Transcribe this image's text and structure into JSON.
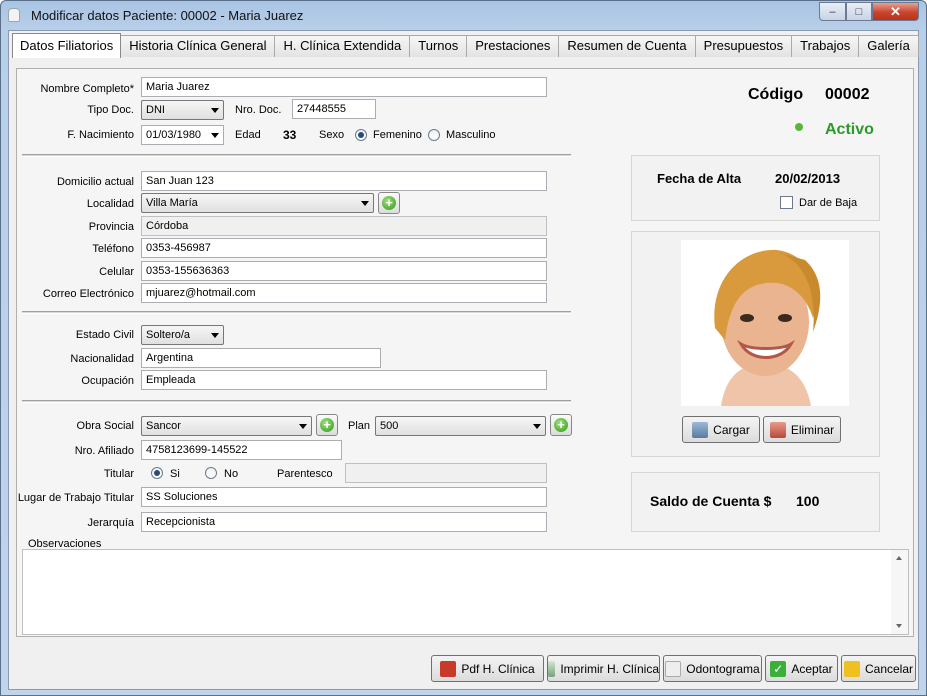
{
  "window": {
    "title": "Modificar datos Paciente: 00002 - Maria Juarez",
    "min": "–",
    "max": "□",
    "close": "✕"
  },
  "tabs": [
    "Datos Filiatorios",
    "Historia Clínica General",
    "H. Clínica Extendida",
    "Turnos",
    "Prestaciones",
    "Resumen de Cuenta",
    "Presupuestos",
    "Trabajos",
    "Galería"
  ],
  "form": {
    "nombre_label": "Nombre Completo*",
    "nombre": "Maria Juarez",
    "tipo_doc_label": "Tipo Doc.",
    "tipo_doc": "DNI",
    "nro_doc_label": "Nro. Doc.",
    "nro_doc": "27448555",
    "nacimiento_label": "F. Nacimiento",
    "nacimiento": "01/03/1980",
    "edad_label": "Edad",
    "edad": "33",
    "sexo_label": "Sexo",
    "sexo_f": "Femenino",
    "sexo_m": "Masculino",
    "domicilio_label": "Domicilio actual",
    "domicilio": "San Juan 123",
    "localidad_label": "Localidad",
    "localidad": "Villa María",
    "provincia_label": "Provincia",
    "provincia": "Córdoba",
    "telefono_label": "Teléfono",
    "telefono": "0353-456987",
    "celular_label": "Celular",
    "celular": "0353-155636363",
    "correo_label": "Correo Electrónico",
    "correo": "mjuarez@hotmail.com",
    "estado_civil_label": "Estado Civil",
    "estado_civil": "Soltero/a",
    "nacionalidad_label": "Nacionalidad",
    "nacionalidad": "Argentina",
    "ocupacion_label": "Ocupación",
    "ocupacion": "Empleada",
    "obra_social_label": "Obra Social",
    "obra_social": "Sancor",
    "plan_label": "Plan",
    "plan": "500",
    "afiliado_label": "Nro. Afiliado",
    "afiliado": "4758123699-145522",
    "titular_label": "Titular",
    "titular_si": "Si",
    "titular_no": "No",
    "parentesco_label": "Parentesco",
    "parentesco": "",
    "lugar_trabajo_label": "Lugar de Trabajo Titular",
    "lugar_trabajo": "SS Soluciones",
    "jerarquia_label": "Jerarquía",
    "jerarquia": "Recepcionista",
    "observaciones_label": "Observaciones",
    "observaciones": "",
    "add_symbol": "+"
  },
  "side": {
    "codigo_label": "Código",
    "codigo": "00002",
    "estado": "Activo",
    "estado_color": "#2a9a2a",
    "fecha_alta_label": "Fecha de Alta",
    "fecha_alta": "20/02/2013",
    "dar_baja": "Dar de Baja",
    "cargar": "Cargar",
    "eliminar": "Eliminar",
    "saldo_label": "Saldo de Cuenta $",
    "saldo": "100"
  },
  "buttons": {
    "pdf": "Pdf H. Clínica",
    "imprimir": "Imprimir H. Clínica",
    "odontograma": "Odontograma",
    "aceptar": "Aceptar",
    "cancelar": "Cancelar"
  }
}
